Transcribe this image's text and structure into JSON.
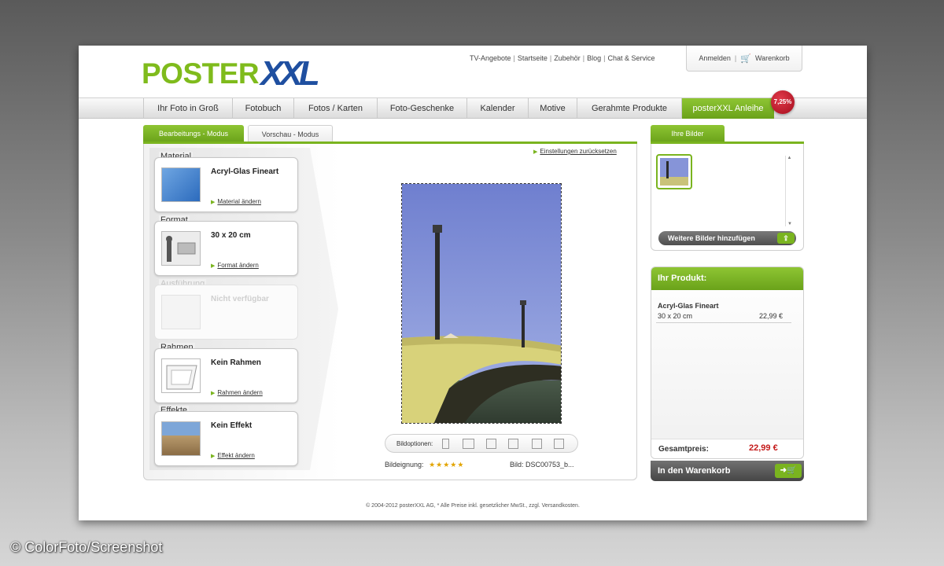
{
  "header": {
    "logo_left": "POSTER",
    "logo_right": "XXL",
    "top_links": [
      "TV-Angebote",
      "Startseite",
      "Zubehör",
      "Blog",
      "Chat & Service"
    ],
    "login": "Anmelden",
    "cart": "Warenkorb"
  },
  "nav": {
    "items": [
      "Ihr Foto in Groß",
      "Fotobuch",
      "Fotos / Karten",
      "Foto-Geschenke",
      "Kalender",
      "Motive",
      "Gerahmte Produkte",
      "posterXXL Anleihe"
    ],
    "badge": "7,25%"
  },
  "tabs": {
    "edit": "Bearbeitungs - Modus",
    "preview": "Vorschau - Modus"
  },
  "reset_link": "Einstellungen zurücksetzen",
  "options": [
    {
      "label": "Material",
      "value": "Acryl-Glas Fineart",
      "link": "Material ändern"
    },
    {
      "label": "Format",
      "value": "30 x 20 cm",
      "link": "Format ändern"
    },
    {
      "label": "Ausführung",
      "value": "Nicht verfügbar",
      "link": ""
    },
    {
      "label": "Rahmen",
      "value": "Kein Rahmen",
      "link": "Rahmen ändern"
    },
    {
      "label": "Effekte",
      "value": "Kein Effekt",
      "link": "Effekt ändern"
    }
  ],
  "image_options_label": "Bildoptionen:",
  "suitability_label": "Bildeignung:",
  "stars": "★★★★★",
  "image_name": "Bild: DSC00753_b...",
  "images_panel": {
    "tab": "Ihre Bilder",
    "add_button": "Weitere Bilder hinzufügen"
  },
  "product": {
    "title": "Ihr Produkt:",
    "name": "Acryl-Glas Fineart",
    "size": "30 x 20 cm",
    "price": "22,99 €",
    "total_label": "Gesamtpreis:",
    "total": "22,99 €",
    "cart_button": "In den Warenkorb"
  },
  "footer": "© 2004-2012 posterXXL AG, * Alle Preise inkl. gesetzlicher MwSt., zzgl. Versandkosten.",
  "credit": "© ColorFoto/Screenshot",
  "colors": {
    "brand_green": "#7ab41f",
    "brand_blue": "#1f4fa0",
    "price_red": "#c41a1a"
  }
}
